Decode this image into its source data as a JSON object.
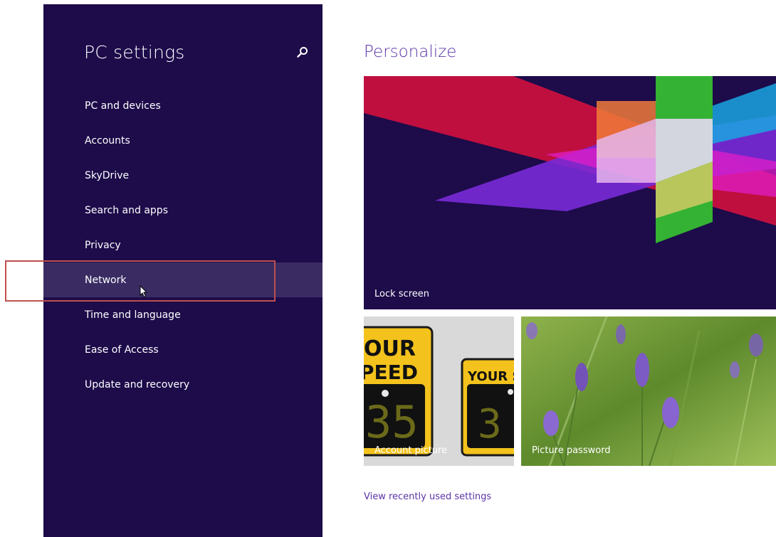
{
  "sidebar": {
    "title": "PC settings",
    "search_icon": "search-icon",
    "items": [
      {
        "label": "PC and devices"
      },
      {
        "label": "Accounts"
      },
      {
        "label": "SkyDrive"
      },
      {
        "label": "Search and apps"
      },
      {
        "label": "Privacy"
      },
      {
        "label": "Network",
        "selected": true
      },
      {
        "label": "Time and language"
      },
      {
        "label": "Ease of Access"
      },
      {
        "label": "Update and recovery"
      }
    ]
  },
  "main": {
    "title": "Personalize",
    "tiles": {
      "lock_screen": "Lock screen",
      "account_picture": "Account picture",
      "picture_password": "Picture password"
    },
    "recent_link": "View recently used settings"
  },
  "colors": {
    "sidebar_bg": "#1d0b4a",
    "selected_bg": "#3a2c63",
    "accent": "#5b34a8",
    "highlight_border": "#c0504d"
  }
}
